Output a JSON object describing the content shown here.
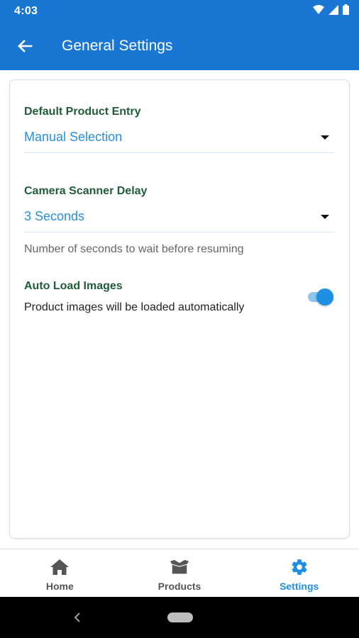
{
  "status_bar": {
    "time": "4:03",
    "icons": [
      "wifi-icon",
      "cell-signal-icon",
      "battery-icon"
    ]
  },
  "toolbar": {
    "title": "General Settings",
    "back_icon": "arrow-left-icon"
  },
  "settings": {
    "product_entry": {
      "label": "Default Product Entry",
      "value": "Manual Selection"
    },
    "scanner_delay": {
      "label": "Camera Scanner Delay",
      "value": "3 Seconds",
      "helper": "Number of seconds to wait before resuming"
    },
    "auto_load": {
      "label": "Auto Load Images",
      "description": "Product images will be loaded automatically",
      "enabled": true
    }
  },
  "bottom_nav": {
    "items": [
      {
        "label": "Home",
        "icon": "home-icon",
        "active": false
      },
      {
        "label": "Products",
        "icon": "box-icon",
        "active": false
      },
      {
        "label": "Settings",
        "icon": "gear-icon",
        "active": true
      }
    ]
  },
  "colors": {
    "primary": "#1976d2",
    "accent": "#1f8fe3",
    "label": "#1f5c37"
  }
}
